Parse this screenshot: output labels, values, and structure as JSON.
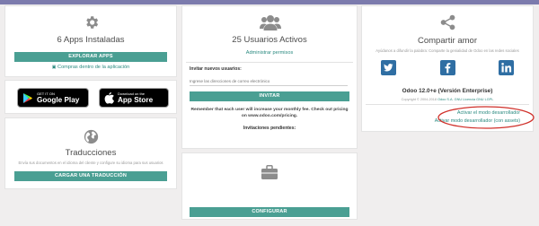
{
  "apps": {
    "count_label": "6 Apps Instaladas",
    "explore_button": "EXPLORAR APPS",
    "purchases_link": "Compras dentro de la aplicación",
    "google_play": {
      "small": "GET IT ON",
      "big": "Google Play"
    },
    "app_store": {
      "small": "Download on the",
      "big": "App Store"
    }
  },
  "translations": {
    "title": "Traducciones",
    "note": "Envía sus documentos en el idioma del cliente y configure su idioma para sus usuarios",
    "load_button": "CARGAR UNA TRADUCCIÓN"
  },
  "users": {
    "title": "25 Usuarios Activos",
    "manage_link": "Administrar permisos",
    "invite_label": "Invitar nuevos usuarios:",
    "invite_placeholder": "Ingrese las direcciones de correo electrónico",
    "invite_button": "INVITAR",
    "pricing_note_1": "Remember that each user will increase your monthly fee. Check out pricing",
    "pricing_note_2": "on www.odoo.com/pricing.",
    "pending_label": "Invitaciones pendientes:"
  },
  "integrations": {
    "configure_button": "CONFIGURAR"
  },
  "share": {
    "title": "Compartir amor",
    "note": "Ayúdanos a difundir la palabra: Comparte la genialidad de Odoo en las redes sociales",
    "version": "Odoo 12.0+e (Versión Enterprise)",
    "copyright": "Copyright © 2004-2018",
    "copyright_link": "Odoo S.A. GNU Licencia GNU LGPL",
    "dev_mode": "Activar el modo desarrollador",
    "dev_mode_assets": "Activar modo desarrollador (con assets)"
  },
  "colors": {
    "accent": "#4a9f93",
    "topbar": "#7c7bad",
    "annotation": "#d0302a"
  }
}
